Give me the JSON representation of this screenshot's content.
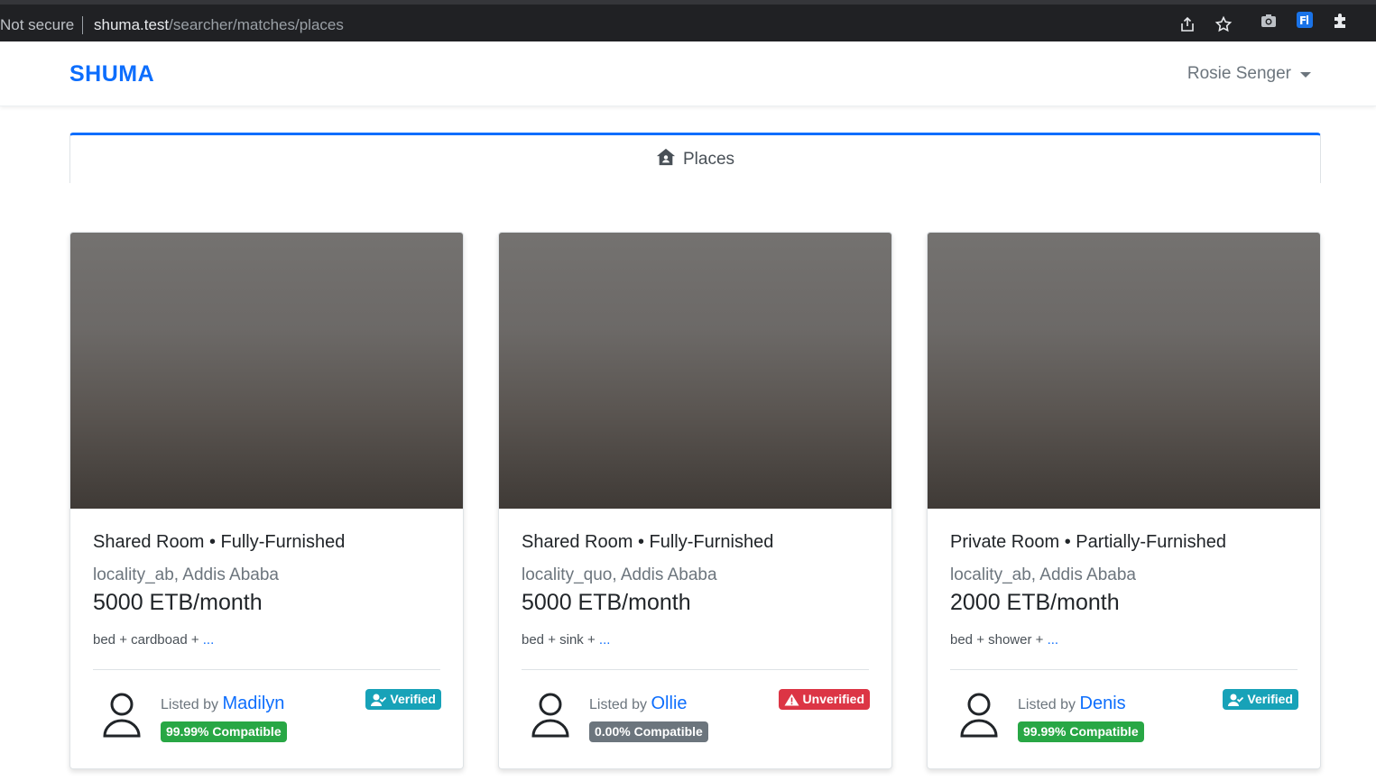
{
  "browser": {
    "security": "Not secure",
    "url_host": "shuma.test",
    "url_path": "/searcher/matches/places",
    "icons": [
      "share-icon",
      "star-icon",
      "camera-icon",
      "extension-f-icon",
      "puzzle-icon"
    ]
  },
  "navbar": {
    "brand": "SHUMA",
    "user": "Rosie Senger"
  },
  "tabs": [
    {
      "label": "Places",
      "icon": "house-user-icon",
      "active": true
    }
  ],
  "cards": [
    {
      "title": "Shared Room • Fully-Furnished",
      "locality": "locality_ab, Addis Ababa",
      "price": "5000 ETB/month",
      "amenities": "bed + cardboad + ",
      "more": "...",
      "listed_by_label": "Listed by",
      "lister": "Madilyn",
      "compatibility": "99.99% Compatible",
      "status": "Verified"
    },
    {
      "title": "Shared Room • Fully-Furnished",
      "locality": "locality_quo, Addis Ababa",
      "price": "5000 ETB/month",
      "amenities": "bed + sink + ",
      "more": "...",
      "listed_by_label": "Listed by",
      "lister": "Ollie",
      "compatibility": "0.00% Compatible",
      "status": "Unverified"
    },
    {
      "title": "Private Room • Partially-Furnished",
      "locality": "locality_ab, Addis Ababa",
      "price": "2000 ETB/month",
      "amenities": "bed + shower + ",
      "more": "...",
      "listed_by_label": "Listed by",
      "lister": "Denis",
      "compatibility": "99.99% Compatible",
      "status": "Verified"
    }
  ],
  "colors": {
    "primary": "#0d6efd",
    "verified": "#17a2b8",
    "unverified": "#dc3545",
    "compatible": "#28a745",
    "incompatible": "#6c757d"
  }
}
